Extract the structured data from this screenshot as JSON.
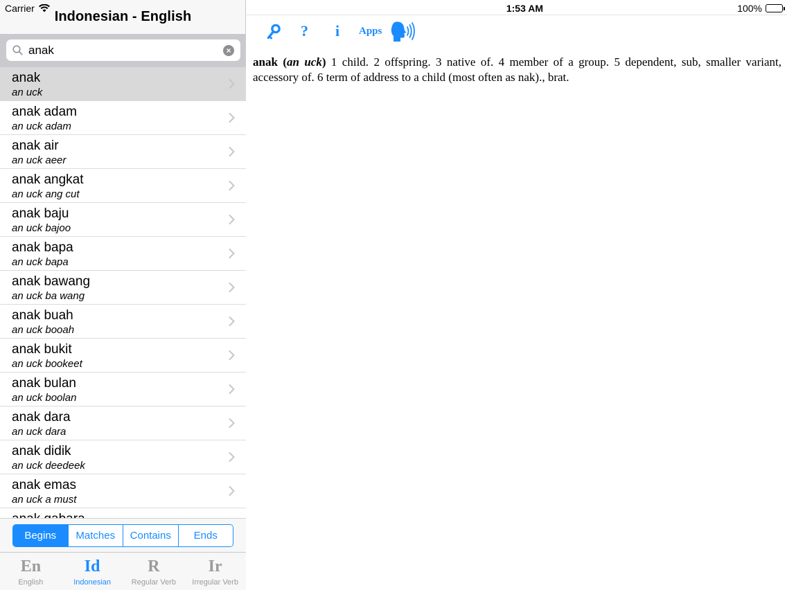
{
  "status": {
    "carrier": "Carrier",
    "time": "1:53 AM",
    "battery": "100%"
  },
  "nav": {
    "title": "Indonesian - English"
  },
  "search": {
    "value": "anak"
  },
  "results": [
    {
      "word": "anak",
      "pron": "an uck",
      "selected": true
    },
    {
      "word": "anak adam",
      "pron": "an uck adam"
    },
    {
      "word": "anak air",
      "pron": "an uck aeer"
    },
    {
      "word": "anak angkat",
      "pron": "an uck ang cut"
    },
    {
      "word": "anak baju",
      "pron": "an uck bajoo"
    },
    {
      "word": "anak bapa",
      "pron": "an uck bapa"
    },
    {
      "word": "anak bawang",
      "pron": "an uck ba wang"
    },
    {
      "word": "anak buah",
      "pron": "an uck booah"
    },
    {
      "word": "anak bukit",
      "pron": "an uck bookeet"
    },
    {
      "word": "anak bulan",
      "pron": "an uck boolan"
    },
    {
      "word": "anak dara",
      "pron": "an uck dara"
    },
    {
      "word": "anak didik",
      "pron": "an uck deedeek"
    },
    {
      "word": "anak emas",
      "pron": "an uck a must"
    },
    {
      "word": "anak gabara",
      "pron": ""
    }
  ],
  "match_modes": [
    {
      "label": "Begins",
      "active": true
    },
    {
      "label": "Matches"
    },
    {
      "label": "Contains"
    },
    {
      "label": "Ends"
    }
  ],
  "tabs": [
    {
      "glyph": "En",
      "label": "English"
    },
    {
      "glyph": "Id",
      "label": "Indonesian",
      "active": true
    },
    {
      "glyph": "R",
      "label": "Regular Verb"
    },
    {
      "glyph": "Ir",
      "label": "Irregular Verb"
    }
  ],
  "toolbar": {
    "key_icon": "key-icon",
    "help_label": "?",
    "info_label": "i",
    "apps_label": "Apps",
    "speak_icon": "speaker-head-icon"
  },
  "definition": {
    "headword": "anak",
    "pron": "an uck",
    "text": " 1 child. 2 offspring. 3 native of. 4 member of a group. 5 dependent, sub, smaller variant, accessory of. 6 term of address to a child (most often as nak)., brat."
  },
  "colors": {
    "accent": "#1a8cff",
    "selected_row": "#d9d9d9",
    "search_bar": "#c9c9ce"
  }
}
